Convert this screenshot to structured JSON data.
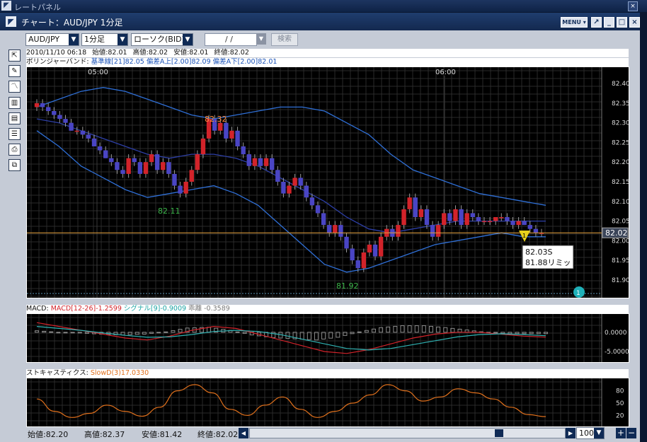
{
  "outer_window": {
    "title": "レートパネル"
  },
  "window": {
    "title": "チャート：AUD/JPY 1分足",
    "menu_label": "MENU",
    "buttons": [
      "↗",
      "_",
      "□",
      "×"
    ]
  },
  "toolbar": {
    "pair": "AUD/JPY",
    "timeframe": "1分足",
    "chart_type": "ローソク(BID)",
    "date_value": "/ /",
    "search_label": "検索"
  },
  "info_bar": {
    "datetime": "2010/11/10 06:18",
    "open": "始値:82.01",
    "high": "高値:82.02",
    "low": "安値:82.01",
    "close": "終値:82.02"
  },
  "bollinger_bar": {
    "label": "ボリンジャーバンド:",
    "mid": "基準線[21]82.05",
    "upper": "偏差A上[2.00]82.09",
    "lower": "偏差A下[2.00]82.01"
  },
  "macd_bar": {
    "label": "MACD:",
    "macd": "MACD[12-26]-1.2599",
    "signal": "シグナル[9]-0.9009",
    "diff": "乖離 -0.3589"
  },
  "stoch_bar": {
    "label": "ストキャスティクス:",
    "slow": "SlowD(3)17.0330"
  },
  "bottom_bar": {
    "open": "始値:82.20",
    "high": "高値:82.37",
    "low": "安値:81.42",
    "close": "終値:82.02",
    "zoom": "100"
  },
  "price_labels": {
    "high_marker": "82.32",
    "low_marker_1": "82.11",
    "low_marker_2": "81.92",
    "current_price": "82.02",
    "order_line1": "82.03S",
    "order_line2": "81.88リミット",
    "order_flag": "1",
    "alert_flag": "1"
  },
  "colors": {
    "up": "#d2232a",
    "down": "#4a45c4",
    "band": "#2f6fd6",
    "mid_band": "#2d3fa6",
    "current_line": "#e8a13a",
    "macd": "#d2232a",
    "signal": "#2fb3b3",
    "stoch": "#e0701c",
    "hist": "#8a8a8a",
    "high_label": "#ff8a3d",
    "low_label": "#3cb54a"
  },
  "chart_data": [
    {
      "type": "candlestick",
      "title": "AUD/JPY 1分足",
      "x_ticks": [
        "05:00",
        "06:00"
      ],
      "y_ticks": [
        "82.40",
        "82.35",
        "82.30",
        "82.25",
        "82.20",
        "82.15",
        "82.10",
        "82.05",
        "82.00",
        "81.95",
        "81.90"
      ],
      "ylim": [
        81.88,
        82.42
      ],
      "grid": true,
      "candles": [
        [
          82.34,
          82.36,
          82.33,
          82.35
        ],
        [
          82.35,
          82.36,
          82.33,
          82.34
        ],
        [
          82.34,
          82.35,
          82.32,
          82.33
        ],
        [
          82.33,
          82.34,
          82.31,
          82.32
        ],
        [
          82.32,
          82.33,
          82.3,
          82.31
        ],
        [
          82.31,
          82.32,
          82.29,
          82.3
        ],
        [
          82.3,
          82.31,
          82.28,
          82.28
        ],
        [
          82.28,
          82.29,
          82.27,
          82.28
        ],
        [
          82.28,
          82.29,
          82.26,
          82.27
        ],
        [
          82.27,
          82.28,
          82.25,
          82.26
        ],
        [
          82.26,
          82.27,
          82.24,
          82.24
        ],
        [
          82.24,
          82.25,
          82.22,
          82.23
        ],
        [
          82.23,
          82.24,
          82.21,
          82.21
        ],
        [
          82.21,
          82.22,
          82.19,
          82.2
        ],
        [
          82.2,
          82.21,
          82.17,
          82.18
        ],
        [
          82.18,
          82.19,
          82.16,
          82.17
        ],
        [
          82.17,
          82.22,
          82.16,
          82.21
        ],
        [
          82.21,
          82.22,
          82.19,
          82.2
        ],
        [
          82.2,
          82.21,
          82.16,
          82.17
        ],
        [
          82.17,
          82.21,
          82.16,
          82.2
        ],
        [
          82.2,
          82.23,
          82.19,
          82.22
        ],
        [
          82.22,
          82.23,
          82.17,
          82.18
        ],
        [
          82.18,
          82.21,
          82.17,
          82.2
        ],
        [
          82.2,
          82.21,
          82.16,
          82.17
        ],
        [
          82.17,
          82.18,
          82.13,
          82.14
        ],
        [
          82.14,
          82.15,
          82.11,
          82.12
        ],
        [
          82.12,
          82.16,
          82.11,
          82.15
        ],
        [
          82.15,
          82.19,
          82.14,
          82.18
        ],
        [
          82.18,
          82.23,
          82.17,
          82.22
        ],
        [
          82.22,
          82.27,
          82.21,
          82.26
        ],
        [
          82.26,
          82.32,
          82.25,
          82.31
        ],
        [
          82.31,
          82.32,
          82.27,
          82.28
        ],
        [
          82.28,
          82.31,
          82.27,
          82.3
        ],
        [
          82.3,
          82.31,
          82.25,
          82.26
        ],
        [
          82.26,
          82.29,
          82.25,
          82.28
        ],
        [
          82.28,
          82.29,
          82.23,
          82.24
        ],
        [
          82.24,
          82.25,
          82.21,
          82.22
        ],
        [
          82.22,
          82.23,
          82.18,
          82.19
        ],
        [
          82.19,
          82.22,
          82.18,
          82.21
        ],
        [
          82.21,
          82.22,
          82.18,
          82.19
        ],
        [
          82.19,
          82.22,
          82.18,
          82.21
        ],
        [
          82.21,
          82.22,
          82.17,
          82.18
        ],
        [
          82.18,
          82.19,
          82.14,
          82.15
        ],
        [
          82.15,
          82.16,
          82.11,
          82.12
        ],
        [
          82.12,
          82.15,
          82.11,
          82.14
        ],
        [
          82.14,
          82.17,
          82.13,
          82.16
        ],
        [
          82.16,
          82.17,
          82.13,
          82.14
        ],
        [
          82.14,
          82.15,
          82.1,
          82.11
        ],
        [
          82.11,
          82.12,
          82.08,
          82.09
        ],
        [
          82.09,
          82.1,
          82.06,
          82.07
        ],
        [
          82.07,
          82.08,
          82.03,
          82.04
        ],
        [
          82.04,
          82.05,
          82.01,
          82.02
        ],
        [
          82.02,
          82.05,
          82.01,
          82.04
        ],
        [
          82.04,
          82.05,
          82.0,
          82.01
        ],
        [
          82.01,
          82.02,
          81.97,
          81.98
        ],
        [
          81.98,
          81.99,
          81.94,
          81.95
        ],
        [
          81.95,
          81.96,
          81.92,
          81.93
        ],
        [
          81.93,
          81.98,
          81.92,
          81.97
        ],
        [
          81.97,
          82.0,
          81.96,
          81.99
        ],
        [
          81.99,
          82.0,
          81.95,
          81.96
        ],
        [
          81.96,
          82.02,
          81.95,
          82.01
        ],
        [
          82.01,
          82.04,
          82.0,
          82.03
        ],
        [
          82.03,
          82.04,
          82.0,
          82.01
        ],
        [
          82.01,
          82.05,
          82.0,
          82.04
        ],
        [
          82.04,
          82.09,
          82.03,
          82.08
        ],
        [
          82.08,
          82.12,
          82.07,
          82.11
        ],
        [
          82.11,
          82.12,
          82.05,
          82.06
        ],
        [
          82.06,
          82.09,
          82.05,
          82.08
        ],
        [
          82.08,
          82.09,
          82.03,
          82.04
        ],
        [
          82.04,
          82.05,
          82.0,
          82.01
        ],
        [
          82.01,
          82.05,
          82.0,
          82.04
        ],
        [
          82.04,
          82.08,
          82.03,
          82.07
        ],
        [
          82.07,
          82.08,
          82.04,
          82.05
        ],
        [
          82.05,
          82.09,
          82.04,
          82.08
        ],
        [
          82.08,
          82.09,
          82.03,
          82.04
        ],
        [
          82.04,
          82.08,
          82.03,
          82.07
        ],
        [
          82.07,
          82.08,
          82.05,
          82.06
        ],
        [
          82.06,
          82.07,
          82.04,
          82.05
        ],
        [
          82.05,
          82.06,
          82.04,
          82.05
        ],
        [
          82.05,
          82.06,
          82.04,
          82.05
        ],
        [
          82.05,
          82.06,
          82.04,
          82.06
        ],
        [
          82.06,
          82.07,
          82.05,
          82.06
        ],
        [
          82.06,
          82.07,
          82.04,
          82.05
        ],
        [
          82.05,
          82.06,
          82.03,
          82.04
        ],
        [
          82.04,
          82.06,
          82.03,
          82.05
        ],
        [
          82.05,
          82.06,
          82.04,
          82.04
        ],
        [
          82.04,
          82.05,
          82.02,
          82.03
        ],
        [
          82.03,
          82.04,
          82.01,
          82.02
        ],
        [
          82.02,
          82.03,
          82.01,
          82.02
        ]
      ],
      "bollinger": {
        "upper": [
          82.34,
          82.36,
          82.38,
          82.39,
          82.38,
          82.36,
          82.34,
          82.32,
          82.31,
          82.32,
          82.33,
          82.34,
          82.34,
          82.33,
          82.3,
          82.27,
          82.22,
          82.18,
          82.16,
          82.14,
          82.12,
          82.11,
          82.1,
          82.09
        ],
        "mid": [
          82.31,
          82.3,
          82.28,
          82.26,
          82.24,
          82.22,
          82.21,
          82.22,
          82.22,
          82.21,
          82.19,
          82.16,
          82.13,
          82.1,
          82.06,
          82.03,
          82.02,
          82.03,
          82.04,
          82.05,
          82.05,
          82.05,
          82.05,
          82.05
        ],
        "lower": [
          82.28,
          82.24,
          82.19,
          82.16,
          82.13,
          82.11,
          82.12,
          82.13,
          82.14,
          82.12,
          82.09,
          82.04,
          81.99,
          81.94,
          81.92,
          81.93,
          81.95,
          81.97,
          81.99,
          82.0,
          82.01,
          82.02,
          82.01,
          82.01
        ]
      }
    },
    {
      "type": "line",
      "title": "MACD",
      "y_ticks": [
        "0.0000",
        "-5.0000"
      ],
      "series": [
        {
          "name": "MACD[12-26]",
          "values": [
            2.5,
            1.5,
            0.5,
            -0.5,
            -1.5,
            -2.0,
            -1.0,
            0.5,
            1.5,
            1.0,
            -0.5,
            -2.0,
            -3.5,
            -5.0,
            -5.5,
            -4.5,
            -3.0,
            -1.5,
            -0.5,
            0.0,
            0.0,
            -0.5,
            -1.0,
            -1.26
          ]
        },
        {
          "name": "シグナル[9]",
          "values": [
            1.5,
            1.0,
            0.5,
            -0.2,
            -0.8,
            -1.3,
            -1.2,
            -0.6,
            0.2,
            0.5,
            0.2,
            -0.6,
            -1.8,
            -3.0,
            -4.2,
            -4.6,
            -4.2,
            -3.2,
            -2.2,
            -1.2,
            -0.6,
            -0.4,
            -0.6,
            -0.9
          ]
        }
      ],
      "histogram": [
        0.4,
        0.0,
        -0.2,
        -0.5,
        -0.7,
        -0.5,
        0.1,
        1.1,
        1.3,
        0.5,
        -0.7,
        -1.4,
        -1.7,
        -2.0,
        -1.3,
        0.1,
        1.2,
        1.7,
        1.7,
        1.2,
        0.6,
        -0.1,
        -0.4,
        -0.36
      ]
    },
    {
      "type": "line",
      "title": "ストキャスティクス",
      "y_ticks": [
        "80",
        "50",
        "20"
      ],
      "series": [
        {
          "name": "SlowD(3)",
          "values": [
            60,
            30,
            15,
            25,
            45,
            30,
            18,
            40,
            80,
            95,
            75,
            35,
            20,
            45,
            65,
            35,
            15,
            30,
            50,
            70,
            95,
            80,
            55,
            65,
            85,
            75,
            60,
            40,
            22,
            17
          ]
        }
      ]
    }
  ]
}
